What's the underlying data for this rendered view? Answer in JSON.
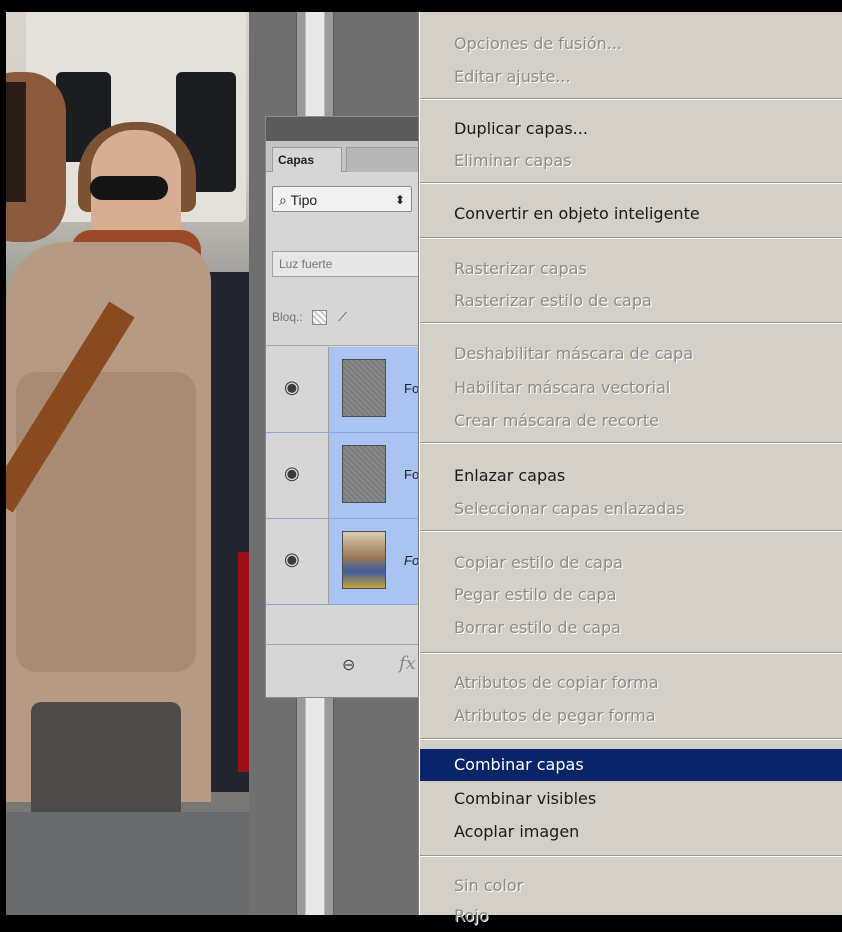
{
  "panel": {
    "tab_label": "Capas",
    "filter_label": "Tipo",
    "filter_search_icon": "search-icon",
    "filter_arrow": "⬍",
    "blend_mode": "Luz fuerte",
    "lock_label": "Bloq.:",
    "layers": [
      {
        "name": "Fo",
        "thumb": "noise",
        "italic": false
      },
      {
        "name": "Fo",
        "thumb": "noise",
        "italic": false
      },
      {
        "name": "Fo",
        "thumb": "image",
        "italic": true
      }
    ],
    "footer_link_icon": "link-icon",
    "footer_fx_label": "fx"
  },
  "menu": {
    "items": [
      {
        "label": "Opciones de fusión...",
        "enabled": false
      },
      {
        "label": "Editar ajuste...",
        "enabled": false
      },
      {
        "label": "Duplicar capas...",
        "enabled": true
      },
      {
        "label": "Eliminar capas",
        "enabled": false
      },
      {
        "label": "Convertir en objeto inteligente",
        "enabled": true
      },
      {
        "label": "Rasterizar capas",
        "enabled": false
      },
      {
        "label": "Rasterizar estilo de capa",
        "enabled": false
      },
      {
        "label": "Deshabilitar máscara de capa",
        "enabled": false
      },
      {
        "label": "Habilitar máscara vectorial",
        "enabled": false
      },
      {
        "label": "Crear máscara de recorte",
        "enabled": false
      },
      {
        "label": "Enlazar capas",
        "enabled": true
      },
      {
        "label": "Seleccionar capas enlazadas",
        "enabled": false
      },
      {
        "label": "Copiar estilo de capa",
        "enabled": false
      },
      {
        "label": "Pegar estilo de capa",
        "enabled": false
      },
      {
        "label": "Borrar estilo de capa",
        "enabled": false
      },
      {
        "label": "Atributos de copiar forma",
        "enabled": false
      },
      {
        "label": "Atributos de pegar forma",
        "enabled": false
      },
      {
        "label": "Combinar capas",
        "enabled": true,
        "selected": true
      },
      {
        "label": "Combinar visibles",
        "enabled": true
      },
      {
        "label": "Acoplar imagen",
        "enabled": true
      },
      {
        "label": "Sin color",
        "enabled": false
      },
      {
        "label": "Rojo",
        "enabled": false
      }
    ]
  },
  "colors": {
    "menu_bg": "#d4d0c8",
    "menu_highlight": "#0a246a",
    "layer_selected": "#a9c3f2"
  }
}
